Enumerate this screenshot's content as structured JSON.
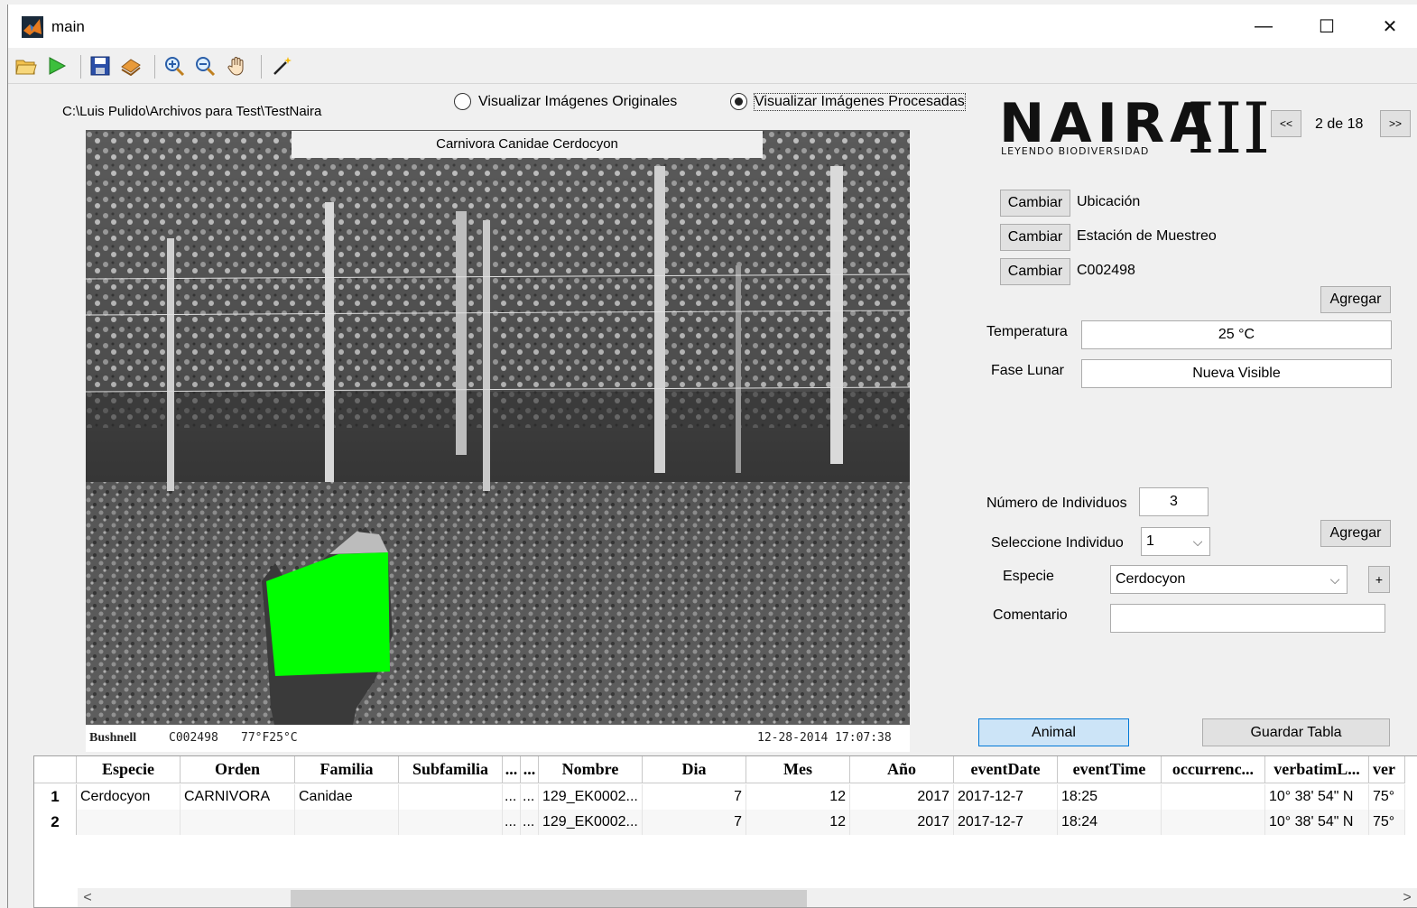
{
  "window": {
    "title": "main",
    "minimize": "—",
    "maximize": "☐",
    "close": "✕"
  },
  "toolbar": {
    "icons": [
      "open-folder-icon",
      "run-icon",
      "save-icon",
      "load-icon",
      "zoom-in-icon",
      "zoom-out-icon",
      "pan-hand-icon",
      "wand-icon"
    ]
  },
  "path": "C:\\Luis Pulido\\Archivos para Test\\TestNaira",
  "view": {
    "original_label": "Visualizar Imágenes Originales",
    "processed_label": "Visualizar Imágenes Procesadas",
    "selected": "processed"
  },
  "image": {
    "title": "Carnivora Canidae Cerdocyon",
    "footer_brand": "Bushnell",
    "footer_code": "C002498",
    "footer_temp": "77°F25°C",
    "footer_datetime": "12-28-2014  17:07:38"
  },
  "logo": {
    "text": "NAIRA",
    "roman": "III",
    "tagline": "LEYENDO BIODIVERSIDAD"
  },
  "pager": {
    "prev": "<<",
    "next": ">>",
    "text": "2 de 18"
  },
  "location": [
    {
      "button": "Cambiar",
      "value": "Ubicación"
    },
    {
      "button": "Cambiar",
      "value": "Estación de Muestreo"
    },
    {
      "button": "Cambiar",
      "value": "C002498"
    }
  ],
  "agregar_top": "Agregar",
  "temperatura": {
    "label": "Temperatura",
    "value": "25 °C"
  },
  "fase_lunar": {
    "label": "Fase Lunar",
    "value": "Nueva Visible"
  },
  "individuos": {
    "label": "Número de Individuos",
    "value": "3"
  },
  "seleccione": {
    "label": "Seleccione Individuo",
    "value": "1"
  },
  "agregar_ind": "Agregar",
  "especie": {
    "label": "Especie",
    "value": "Cerdocyon",
    "add": "+"
  },
  "comentario": {
    "label": "Comentario",
    "value": ""
  },
  "animal_button": "Animal",
  "guardar_button": "Guardar Tabla",
  "table": {
    "headers": [
      "Especie",
      "Orden",
      "Familia",
      "Subfamilia",
      "...",
      "...",
      "Nombre",
      "Dia",
      "Mes",
      "Año",
      "eventDate",
      "eventTime",
      "occurrenc...",
      "verbatimL...",
      "ver"
    ],
    "rows": [
      [
        "1",
        "Cerdocyon",
        "CARNIVORA",
        "Canidae",
        "",
        "...",
        "...",
        "129_EK0002...",
        "7",
        "12",
        "2017",
        "2017-12-7",
        "18:25",
        "",
        "10° 38' 54\" N",
        "75°"
      ],
      [
        "2",
        "",
        "",
        "",
        "",
        "...",
        "...",
        "129_EK0002...",
        "7",
        "12",
        "2017",
        "2017-12-7",
        "18:24",
        "",
        "10° 38' 54\" N",
        "75°"
      ]
    ]
  },
  "scroll": {
    "left": "<",
    "right": ">"
  },
  "colors": {
    "highlight": "#00ff00",
    "animal_button_bg": "#cce4f7",
    "animal_button_border": "#0078d7"
  }
}
